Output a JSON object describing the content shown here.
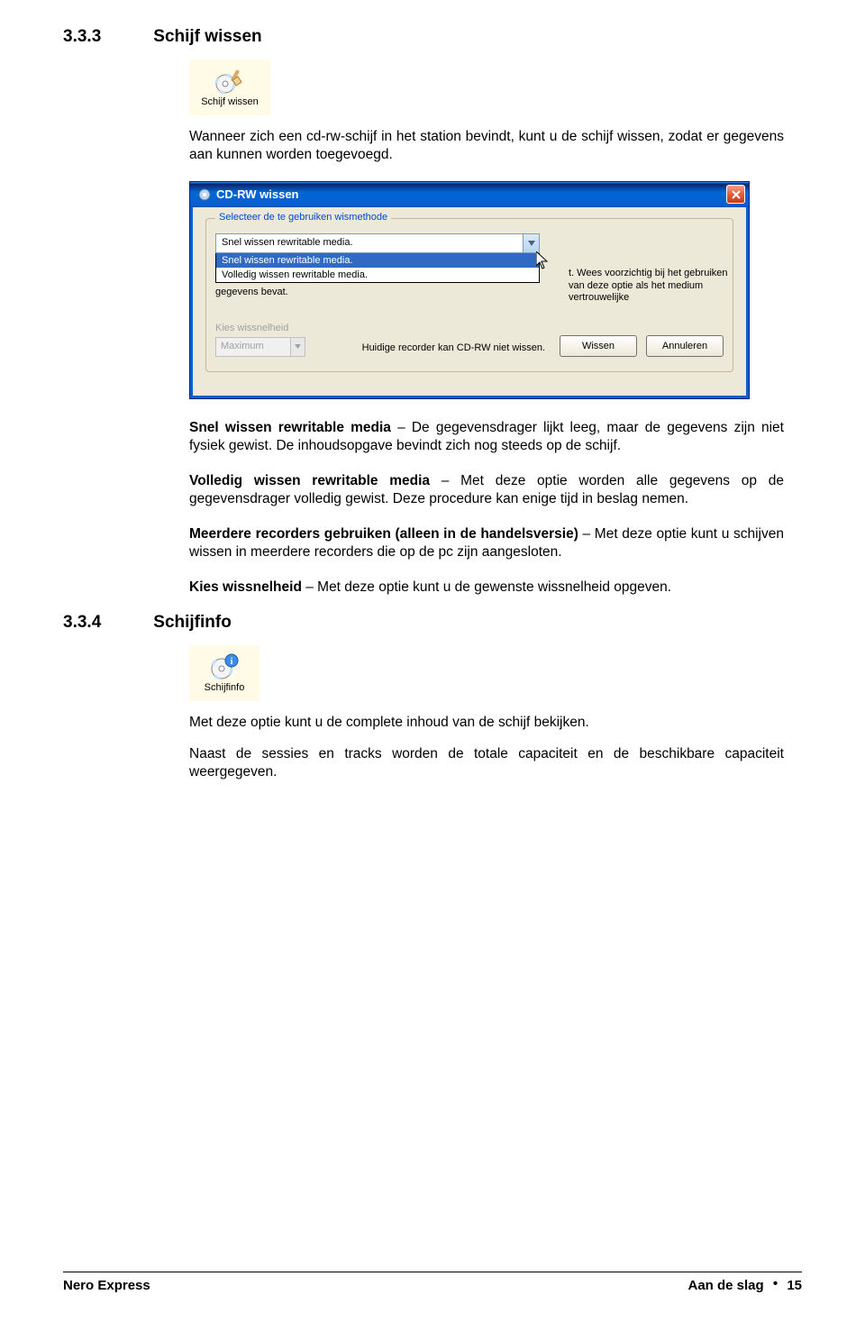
{
  "sections": {
    "s333": {
      "number": "3.3.3",
      "title": "Schijf wissen"
    },
    "s334": {
      "number": "3.3.4",
      "title": "Schijfinfo"
    }
  },
  "icons": {
    "wissen_label": "Schijf wissen",
    "info_label": "Schijfinfo"
  },
  "paragraphs": {
    "intro333": "Wanneer zich een cd-rw-schijf in het station bevindt, kunt u de schijf wissen, zodat er gegevens aan kunnen worden toegevoegd.",
    "snel_label": "Snel wissen rewritable media",
    "snel_text": " – De gegevensdrager lijkt leeg, maar de gegevens zijn niet fysiek gewist. De inhoudsopgave bevindt zich nog steeds op de schijf.",
    "volledig_label": "Volledig wissen rewritable media",
    "volledig_text": " – Met deze optie worden alle gegevens op de gegevensdrager volledig gewist. Deze procedure kan enige tijd in beslag nemen.",
    "meerdere_label": "Meerdere recorders gebruiken (alleen in de handelsversie)",
    "meerdere_text": " – Met deze optie kunt u schijven wissen in meerdere recorders die op de pc zijn aangesloten.",
    "kies_label": "Kies wissnelheid",
    "kies_text": " – Met deze optie kunt u de gewenste wissnelheid opgeven.",
    "intro334": "Met deze optie kunt u de complete inhoud van de schijf bekijken.",
    "naast334": "Naast de sessies en tracks worden de totale capaciteit en de beschikbare capaciteit weergegeven."
  },
  "dialog": {
    "title": "CD-RW wissen",
    "group_legend": "Selecteer de te gebruiken wismethode",
    "combo_value": "Snel wissen rewritable media.",
    "combo_items": [
      "Snel wissen rewritable media.",
      "Volledig wissen rewritable media."
    ],
    "hint_right": "t. Wees voorzichtig bij het gebruiken van deze optie als het medium vertrouwelijke",
    "gegevens_line": "gegevens bevat.",
    "kies_label": "Kies wissnelheid",
    "speed_value": "Maximum",
    "recorder_note": "Huidige recorder kan CD-RW niet wissen.",
    "btn_wissen": "Wissen",
    "btn_annuleren": "Annuleren"
  },
  "footer": {
    "left": "Nero Express",
    "right_section": "Aan de slag",
    "bullet": "•",
    "page": "15"
  }
}
